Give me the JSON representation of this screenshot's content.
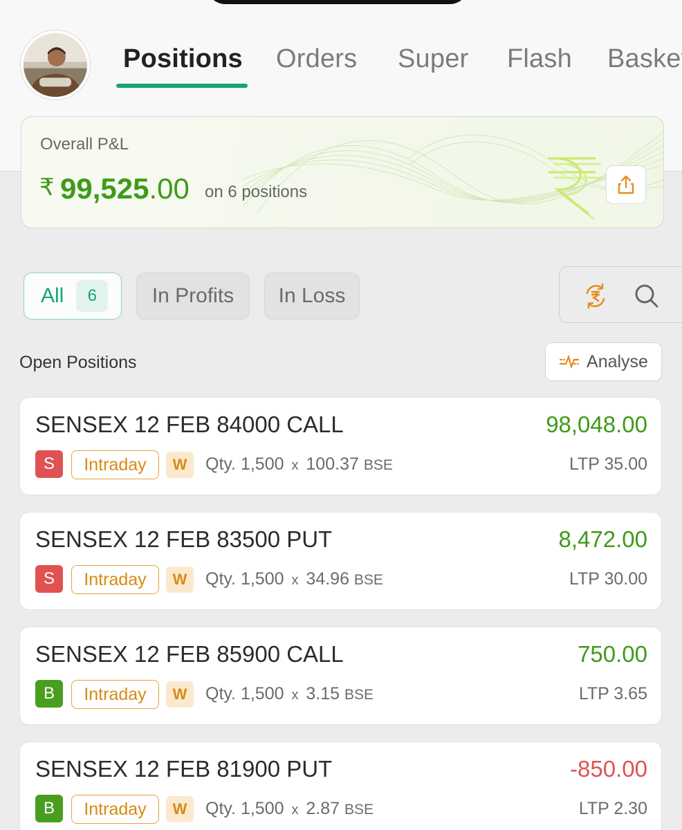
{
  "header": {
    "tabs": [
      {
        "label": "Positions",
        "active": true
      },
      {
        "label": "Orders",
        "active": false
      },
      {
        "label": "Super",
        "active": false
      },
      {
        "label": "Flash",
        "active": false
      },
      {
        "label": "Basket",
        "active": false
      }
    ]
  },
  "pnl_card": {
    "label": "Overall P&L",
    "currency_symbol": "₹",
    "value_int": "99,525",
    "value_dec": ".00",
    "positions_text": "on 6 positions",
    "share_icon": "share-icon",
    "watermark_icon": "rupee-icon"
  },
  "filters": [
    {
      "label": "All",
      "count": "6",
      "active": true
    },
    {
      "label": "In Profits",
      "active": false
    },
    {
      "label": "In Loss",
      "active": false
    }
  ],
  "tools": {
    "convert_icon": "rupee-convert-icon",
    "search_icon": "search-icon"
  },
  "section": {
    "label": "Open Positions",
    "analyse_label": "Analyse"
  },
  "positions": [
    {
      "name": "SENSEX 12 FEB 84000 CALL",
      "pnl": "98,048.00",
      "side": "S",
      "type": "Intraday",
      "w": "W",
      "qty_label": "Qty.",
      "qty": "1,500",
      "x": "x",
      "avg": "100.37",
      "exchange": "BSE",
      "ltp_label": "LTP",
      "ltp": "35.00"
    },
    {
      "name": "SENSEX 12 FEB 83500 PUT",
      "pnl": "8,472.00",
      "side": "S",
      "type": "Intraday",
      "w": "W",
      "qty_label": "Qty.",
      "qty": "1,500",
      "x": "x",
      "avg": "34.96",
      "exchange": "BSE",
      "ltp_label": "LTP",
      "ltp": "30.00"
    },
    {
      "name": "SENSEX 12 FEB 85900 CALL",
      "pnl": "750.00",
      "side": "B",
      "type": "Intraday",
      "w": "W",
      "qty_label": "Qty.",
      "qty": "1,500",
      "x": "x",
      "avg": "3.15",
      "exchange": "BSE",
      "ltp_label": "LTP",
      "ltp": "3.65"
    },
    {
      "name": "SENSEX 12 FEB 81900 PUT",
      "pnl": "-850.00",
      "side": "B",
      "type": "Intraday",
      "w": "W",
      "qty_label": "Qty.",
      "qty": "1,500",
      "x": "x",
      "avg": "2.87",
      "exchange": "BSE",
      "ltp_label": "LTP",
      "ltp": "2.30"
    }
  ],
  "colors": {
    "accent": "#13a47a",
    "profit": "#3f9a1a",
    "loss": "#e05252",
    "sell": "#e05252",
    "buy": "#4a9e1f",
    "orange": "#d98a12"
  }
}
